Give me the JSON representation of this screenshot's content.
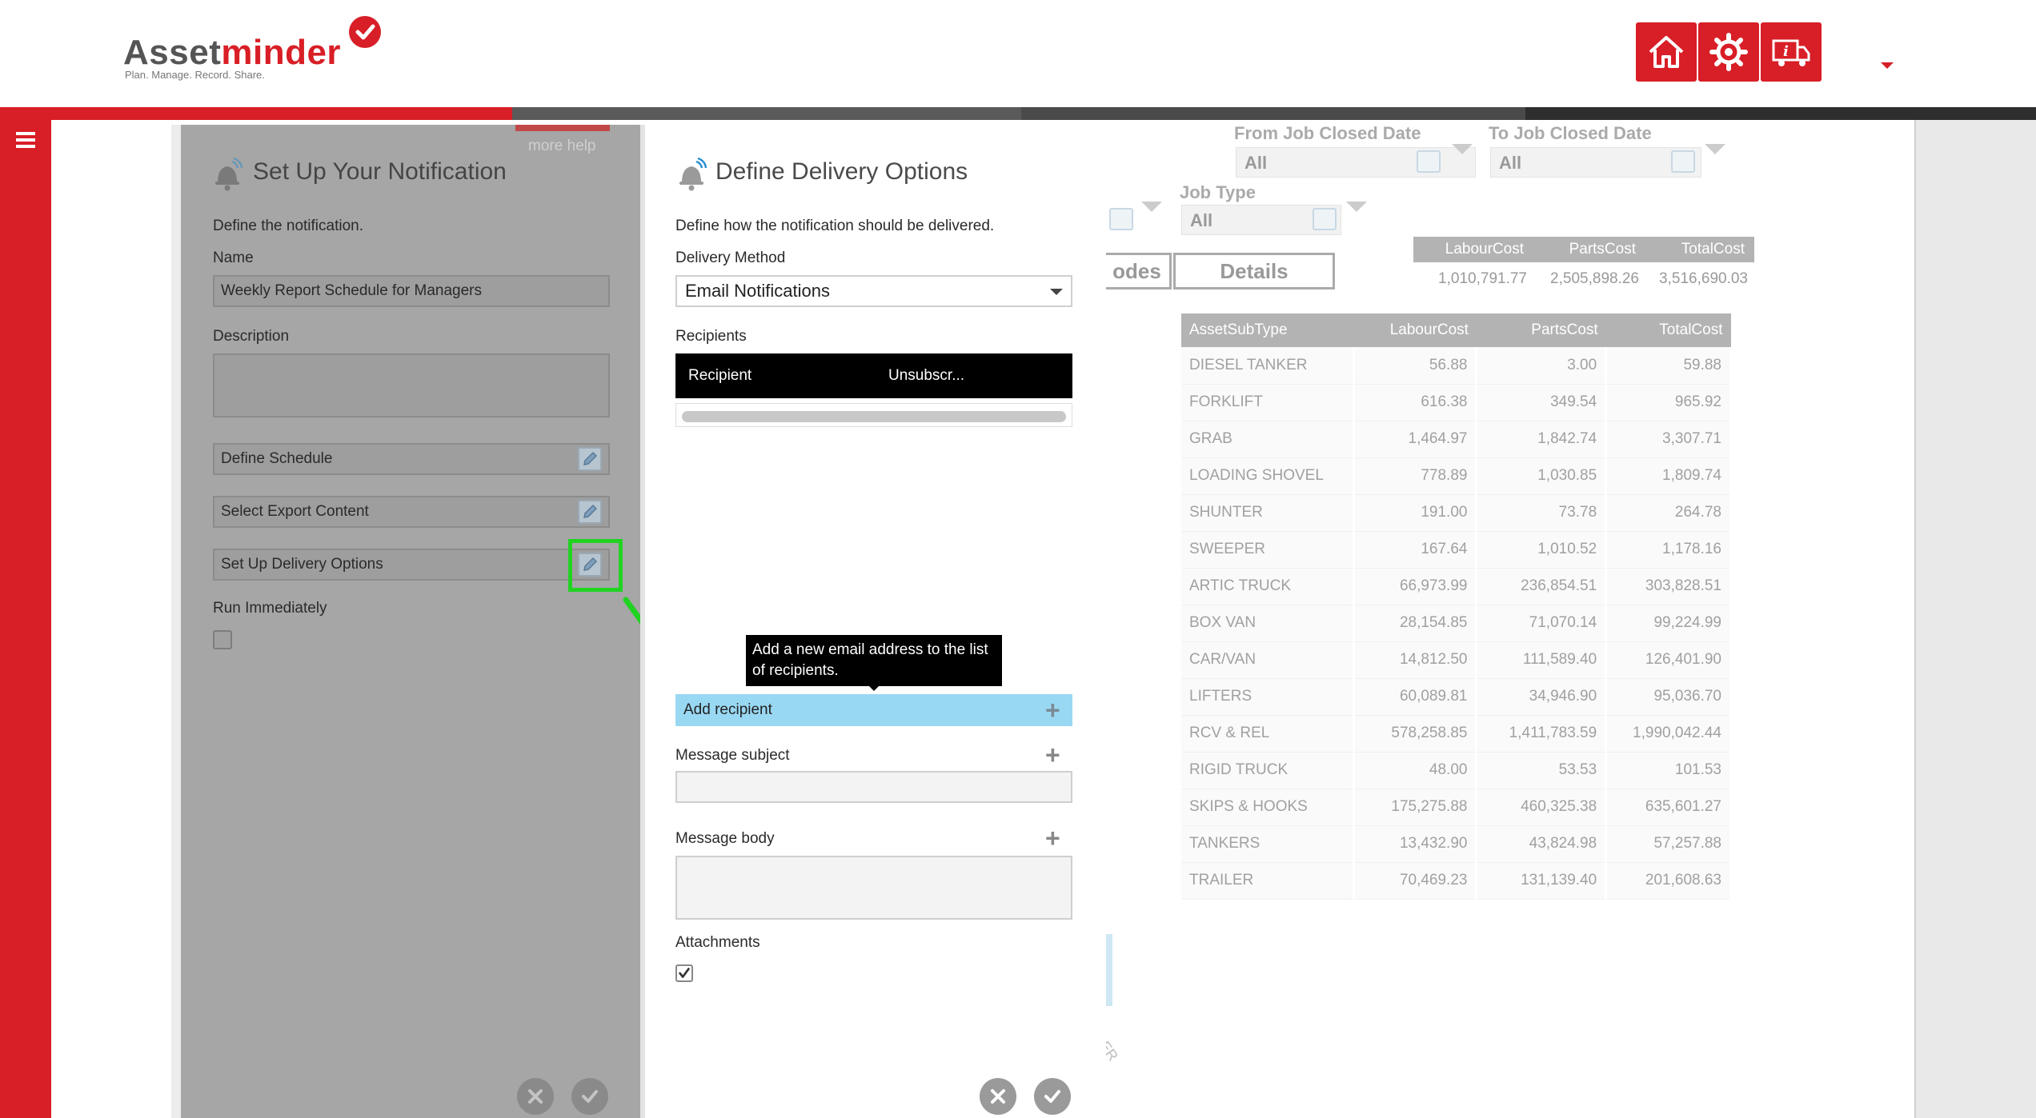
{
  "brand": {
    "name_part1": "Asset",
    "name_part2": "minder",
    "tagline": "Plan. Manage. Record. Share.",
    "accent": "#d81e26"
  },
  "header": {
    "buttons": [
      {
        "icon": "home-icon"
      },
      {
        "icon": "gear-icon"
      },
      {
        "icon": "truck-info-icon"
      }
    ]
  },
  "report": {
    "filters": {
      "from_label": "From Job Closed Date",
      "from_value": "All",
      "to_label": "To Job Closed Date",
      "to_value": "All",
      "jobtype_label": "Job Type",
      "jobtype_value": "All"
    },
    "codes_btn": "odes",
    "details_btn": "Details",
    "totals": {
      "headers": [
        "LabourCost",
        "PartsCost",
        "TotalCost"
      ],
      "values": [
        "1,010,791.77",
        "2,505,898.26",
        "3,516,690.03"
      ]
    },
    "detail": {
      "headers": [
        "AssetSubType",
        "LabourCost",
        "PartsCost",
        "TotalCost"
      ],
      "rows": [
        [
          "DIESEL TANKER",
          "56.88",
          "3.00",
          "59.88"
        ],
        [
          "FORKLIFT",
          "616.38",
          "349.54",
          "965.92"
        ],
        [
          "GRAB",
          "1,464.97",
          "1,842.74",
          "3,307.71"
        ],
        [
          "LOADING SHOVEL",
          "778.89",
          "1,030.85",
          "1,809.74"
        ],
        [
          "SHUNTER",
          "191.00",
          "73.78",
          "264.78"
        ],
        [
          "SWEEPER",
          "167.64",
          "1,010.52",
          "1,178.16"
        ],
        [
          "ARTIC TRUCK",
          "66,973.99",
          "236,854.51",
          "303,828.51"
        ],
        [
          "BOX VAN",
          "28,154.85",
          "71,070.14",
          "99,224.99"
        ],
        [
          "CAR/VAN",
          "14,812.50",
          "111,589.40",
          "126,401.90"
        ],
        [
          "LIFTERS",
          "60,089.81",
          "34,946.90",
          "95,036.70"
        ],
        [
          "RCV & REL",
          "578,258.85",
          "1,411,783.59",
          "1,990,042.44"
        ],
        [
          "RIGID TRUCK",
          "48.00",
          "53.53",
          "101.53"
        ],
        [
          "SKIPS & HOOKS",
          "175,275.88",
          "460,325.38",
          "635,601.27"
        ],
        [
          "TANKERS",
          "13,432.90",
          "43,824.98",
          "57,257.88"
        ],
        [
          "TRAILER",
          "70,469.23",
          "131,139.40",
          "201,608.63"
        ]
      ]
    },
    "axis_fragment": "ILER"
  },
  "notification": {
    "more_help": "more help",
    "title": "Set Up Your Notification",
    "intro": "Define the notification.",
    "name_label": "Name",
    "name_value": "Weekly Report Schedule for Managers",
    "description_label": "Description",
    "description_value": "",
    "steps": [
      "Define Schedule",
      "Select Export Content",
      "Set Up Delivery Options"
    ],
    "run_immediately_label": "Run Immediately",
    "run_immediately_checked": false
  },
  "delivery": {
    "title": "Define Delivery Options",
    "intro": "Define how the notification should be delivered.",
    "method_label": "Delivery Method",
    "method_value": "Email Notifications",
    "recipients_label": "Recipients",
    "recipients_columns": [
      "Recipient",
      "Unsubscr..."
    ],
    "tooltip": "Add a new email address to the list of recipients.",
    "add_recipient": "Add recipient",
    "subject_label": "Message subject",
    "subject_value": "",
    "body_label": "Message body",
    "body_value": "",
    "attachments_label": "Attachments",
    "attachments_checked": true
  },
  "colors": {
    "highlight": "#21d321",
    "add_recipient_bg": "#99d8f3"
  }
}
